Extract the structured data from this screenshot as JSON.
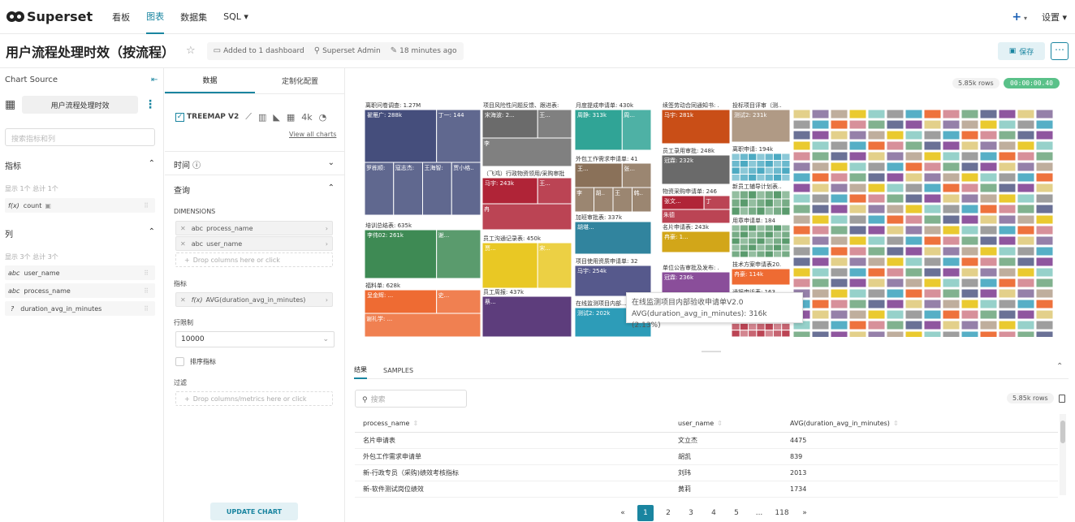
{
  "topnav": {
    "brand": "Superset",
    "items": [
      "看板",
      "图表",
      "数据集",
      "SQL ▾"
    ],
    "active_index": 1,
    "plus": "+",
    "settings": "设置 ▾"
  },
  "header": {
    "title": "用户流程处理时效（按流程）",
    "dashboards": "Added to 1 dashboard",
    "owner": "Superset Admin",
    "modified": "18 minutes ago",
    "save": "保存"
  },
  "left": {
    "chart_source": "Chart Source",
    "dataset": "用户流程处理时效",
    "search_placeholder": "搜索指标和列",
    "metrics_title": "指标",
    "metrics_count": "显示 1个 总计 1个",
    "metrics": [
      {
        "type": "f(x)",
        "name": "count"
      }
    ],
    "columns_title": "列",
    "columns_count": "显示 3个 总计 3个",
    "columns": [
      {
        "type": "abc",
        "name": "user_name"
      },
      {
        "type": "abc",
        "name": "process_name"
      },
      {
        "type": "?",
        "name": "duration_avg_in_minutes"
      }
    ]
  },
  "mid": {
    "tabs": [
      "数据",
      "定制化配置"
    ],
    "viz_type": "TREEMAP V2",
    "viz_4k": "4k",
    "view_all": "View all charts",
    "time": "时间 ⓘ",
    "query": "查询",
    "dimensions_label": "DIMENSIONS",
    "dimensions": [
      "process_name",
      "user_name"
    ],
    "drop_cols": "Drop columns here or click",
    "metrics_label": "指标",
    "metric": "AVG(duration_avg_in_minutes)",
    "row_limit_label": "行限制",
    "row_limit": "10000",
    "sort_label": "排序指标",
    "filter_label": "过滤",
    "drop_filter": "Drop columns/metrics here or click",
    "update": "UPDATE CHART"
  },
  "chart": {
    "rows": "5.85k rows",
    "time": "00:00:00.40"
  },
  "tooltip": {
    "title": "在线监测项目内部验收申请单V2.0",
    "value": "AVG(duration_avg_in_minutes): 316k (2.13%)"
  },
  "chart_data": {
    "type": "treemap",
    "groups": [
      {
        "name": "离职问卷调查: 1.27M",
        "color": "#454e7c",
        "cells": [
          "翟雁广: 288k",
          "丁一: 144k",
          "罗栋顺: 285k",
          "寇志杰: 1...",
          "王海智: 285k",
          "贾小格..."
        ]
      },
      {
        "name": "培训总结表: 635k",
        "color": "#3e8a54",
        "cells": [
          "李伟02: 261k",
          "谢..."
        ]
      },
      {
        "name": "福料单: 628k",
        "color": "#ee6b33",
        "cells": [
          "呈金辉: ...",
          "史...",
          "谢礼学: ..."
        ]
      },
      {
        "name": "项目风险性问题反馈、跟进表: 46",
        "color": "#6b6b6b",
        "cells": [
          "宋海波: 2...",
          "王...",
          "李"
        ]
      },
      {
        "name": "（飞鸿）行政物资领用/采购审批",
        "color": "#b02437",
        "cells": [
          "马宇: 243k",
          "王...",
          "冉"
        ]
      },
      {
        "name": "员工沟通记录表: 450k",
        "color": "#e9c824",
        "cells": [
          "贾...",
          "宋..."
        ]
      },
      {
        "name": "员工周报: 437k",
        "color": "#5d3d7c",
        "cells": [
          "蔡..."
        ]
      },
      {
        "name": "月度提成申请单: 430k",
        "color": "#30a496",
        "cells": [
          "周静: 313k",
          "周..."
        ]
      },
      {
        "name": "外包工作需求申请单: 418k",
        "color": "#8a7159",
        "cells": [
          "王...",
          "张...",
          "李",
          "胡...",
          "王",
          "韩..."
        ]
      },
      {
        "name": "加班审批表: 337k",
        "color": "#31849e",
        "cells": [
          "胡堪..."
        ]
      },
      {
        "name": "项目使用资质申请单: 326k",
        "color": "#56598c",
        "cells": [
          "马宇: 254k"
        ]
      },
      {
        "name": "在线监测项目内部...",
        "color": "#2d9cb8",
        "cells": [
          "测试2: 202k"
        ]
      },
      {
        "name": "续签劳动合同通知书: ...",
        "color": "#c94e17",
        "cells": [
          "马宇: 281k"
        ]
      },
      {
        "name": "员工录用审批: 248k",
        "color": "#6a6a6a",
        "cells": [
          "冠霖: 232k"
        ]
      },
      {
        "name": "物资采购申请单: 246k",
        "color": "#b02437",
        "cells": [
          "张文...",
          "丁",
          "朱德"
        ]
      },
      {
        "name": "名片申请表: 243k",
        "color": "#d2a619",
        "cells": [
          "冉豪: 1..."
        ]
      },
      {
        "name": "单位公告审批及发布: ...",
        "color": "#8a4e9a",
        "cells": [
          "冠霖: 236k"
        ]
      },
      {
        "name": "投标项目评审（测...",
        "color": "#b09a85",
        "cells": [
          "测试2: 231k"
        ]
      },
      {
        "name": "离职申请: 194k",
        "color": "#2d9cb8",
        "cells": []
      },
      {
        "name": "新员工辅导计划表...",
        "color": "#3e8a54",
        "cells": []
      },
      {
        "name": "用章申请单: 184k",
        "color": "#3e8a54",
        "cells": []
      },
      {
        "name": "技术方案申请表20...",
        "color": "#ee6b33",
        "cells": [
          "冉豪: 114k"
        ]
      },
      {
        "name": "通报申诉表: 163k",
        "color": "#b02437",
        "cells": []
      }
    ]
  },
  "results": {
    "tabs": [
      "结果",
      "SAMPLES"
    ],
    "search_placeholder": "搜索",
    "rows": "5.85k rows",
    "headers": [
      "process_name",
      "user_name",
      "AVG(duration_avg_in_minutes)"
    ],
    "data": [
      [
        "名片申请表",
        "文立杰",
        "4475"
      ],
      [
        "外包工作需求申请单",
        "胡凯",
        "839"
      ],
      [
        "新-行政专员（采购)绩效考核指标",
        "刘玮",
        "2013"
      ],
      [
        "新-软件测试岗位绩效",
        "黄莉",
        "1734"
      ]
    ],
    "pages": [
      "«",
      "1",
      "2",
      "3",
      "4",
      "5",
      "...",
      "118",
      "»"
    ]
  }
}
